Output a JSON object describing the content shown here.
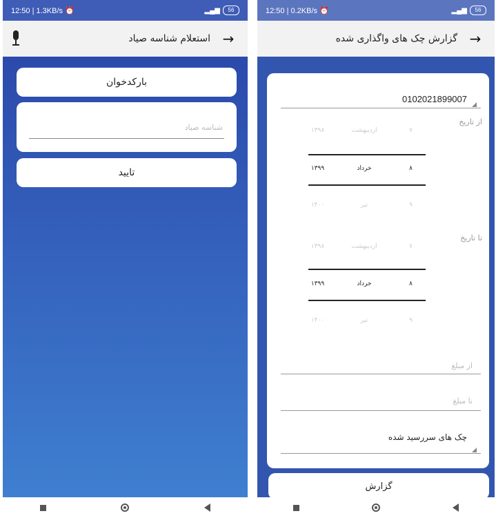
{
  "left": {
    "status": {
      "time": "12:50 | 1.3KB/s ⏰",
      "battery": "56"
    },
    "appbar": {
      "title": "استعلام شناسه صیاد"
    },
    "barcode_button": "بارکدخوان",
    "id_input": {
      "placeholder": "شناسه صیاد",
      "value": ""
    },
    "confirm_button": "تایید"
  },
  "right": {
    "status": {
      "time": "12:50 | 0.2KB/s ⏰",
      "battery": "56"
    },
    "appbar": {
      "title": "گزارش چک های واگذاری شده"
    },
    "account_select": "0102021899007",
    "from_date": {
      "label": "از تاریخ",
      "rows": [
        {
          "day": "۷",
          "month": "اردیبهشت",
          "year": "۱۳۹۸"
        },
        {
          "day": "۸",
          "month": "خرداد",
          "year": "۱۳۹۹"
        },
        {
          "day": "۹",
          "month": "تیر",
          "year": "۱۴۰۰"
        }
      ]
    },
    "to_date": {
      "label": "تا تاریخ",
      "rows": [
        {
          "day": "۷",
          "month": "اردیبهشت",
          "year": "۱۳۹۸"
        },
        {
          "day": "۸",
          "month": "خرداد",
          "year": "۱۳۹۹"
        },
        {
          "day": "۹",
          "month": "تیر",
          "year": "۱۴۰۰"
        }
      ]
    },
    "from_amount": {
      "placeholder": "از مبلغ",
      "value": ""
    },
    "to_amount": {
      "placeholder": "تا مبلغ",
      "value": ""
    },
    "check_type_select": "چک های سررسید شده",
    "report_button": "گزارش"
  },
  "icons": {
    "back": "arrow-right-icon",
    "mic": "microphone-icon"
  },
  "colors": {
    "gradient_top": "#2c4aac",
    "gradient_bottom": "#3f7fd0",
    "appbar": "#f2f2f2"
  }
}
